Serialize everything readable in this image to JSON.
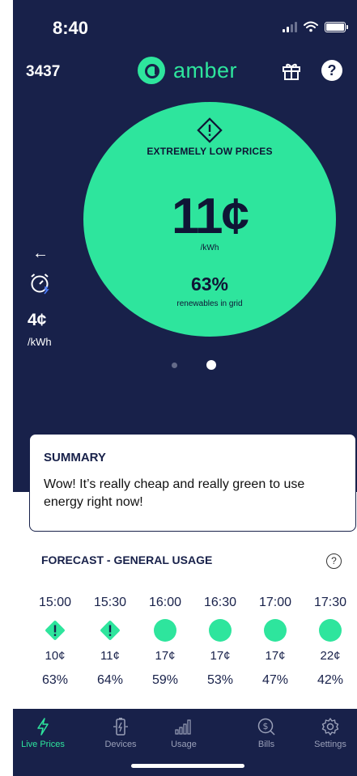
{
  "status": {
    "time": "8:40"
  },
  "header": {
    "account_id": "3437",
    "logo_text": "amber",
    "help_glyph": "?"
  },
  "hero": {
    "label": "EXTREMELY LOW PRICES",
    "price": "11¢",
    "price_unit": "/kWh",
    "renewables": "63%",
    "renewables_label": "renewables in grid"
  },
  "side": {
    "arrow": "←",
    "price": "4¢",
    "unit": "/kWh"
  },
  "pager": {
    "count": 2,
    "active_index": 1
  },
  "summary": {
    "title": "SUMMARY",
    "text": "Wow! It’s really cheap and really green to use energy right now!"
  },
  "forecast": {
    "title": "FORECAST - GENERAL USAGE",
    "help_glyph": "?",
    "items": [
      {
        "time": "15:00",
        "marker": "warning-diamond",
        "price": "10¢",
        "renewables": "63%"
      },
      {
        "time": "15:30",
        "marker": "warning-diamond",
        "price": "11¢",
        "renewables": "64%"
      },
      {
        "time": "16:00",
        "marker": "circle",
        "price": "17¢",
        "renewables": "59%"
      },
      {
        "time": "16:30",
        "marker": "circle",
        "price": "17¢",
        "renewables": "53%"
      },
      {
        "time": "17:00",
        "marker": "circle",
        "price": "17¢",
        "renewables": "47%"
      },
      {
        "time": "17:30",
        "marker": "circle",
        "price": "22¢",
        "renewables": "42%"
      }
    ]
  },
  "tabs": [
    {
      "label": "Live Prices",
      "icon": "lightning-icon",
      "active": true
    },
    {
      "label": "Devices",
      "icon": "battery-icon",
      "active": false
    },
    {
      "label": "Usage",
      "icon": "bar-chart-icon",
      "active": false
    },
    {
      "label": "Bills",
      "icon": "dollar-search-icon",
      "active": false
    },
    {
      "label": "Settings",
      "icon": "gear-icon",
      "active": false
    }
  ],
  "colors": {
    "navy": "#18214a",
    "green": "#2ee59d",
    "tab_inactive": "#9aa0b8"
  }
}
